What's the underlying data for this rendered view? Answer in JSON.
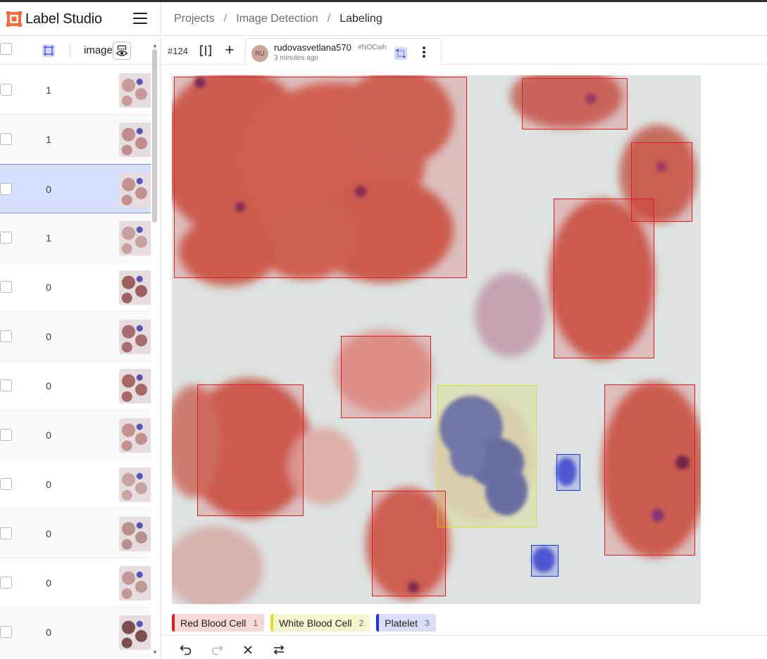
{
  "app": {
    "name": "Label Studio",
    "breadcrumb": [
      "Projects",
      "Image Detection",
      "Labeling"
    ],
    "breadcrumb_sep": "/"
  },
  "list": {
    "column_image": "image",
    "rows": [
      {
        "count": "1"
      },
      {
        "count": "1"
      },
      {
        "count": "0"
      },
      {
        "count": "1"
      },
      {
        "count": "0"
      },
      {
        "count": "0"
      },
      {
        "count": "0"
      },
      {
        "count": "0"
      },
      {
        "count": "0"
      },
      {
        "count": "0"
      },
      {
        "count": "0"
      },
      {
        "count": "0"
      }
    ],
    "selected_row_index": 2
  },
  "annotation": {
    "task_id": "#124",
    "avatar_initials": "RU",
    "user": "rudovasvetlana570",
    "code": "#NOCwh",
    "time": "3 minutes ago"
  },
  "labels": [
    {
      "name": "Red Blood Cell",
      "hotkey": "1",
      "color": "#e01e1e",
      "bg": "#f6d8d4"
    },
    {
      "name": "White Blood Cell",
      "hotkey": "2",
      "color": "#e0e01e",
      "bg": "#f6f5d0"
    },
    {
      "name": "Platelet",
      "hotkey": "3",
      "color": "#1e32e0",
      "bg": "#d9def8"
    }
  ],
  "icons": {
    "undo": "undo-icon",
    "redo": "redo-icon",
    "reset": "close-icon",
    "settings": "swap-icon"
  }
}
